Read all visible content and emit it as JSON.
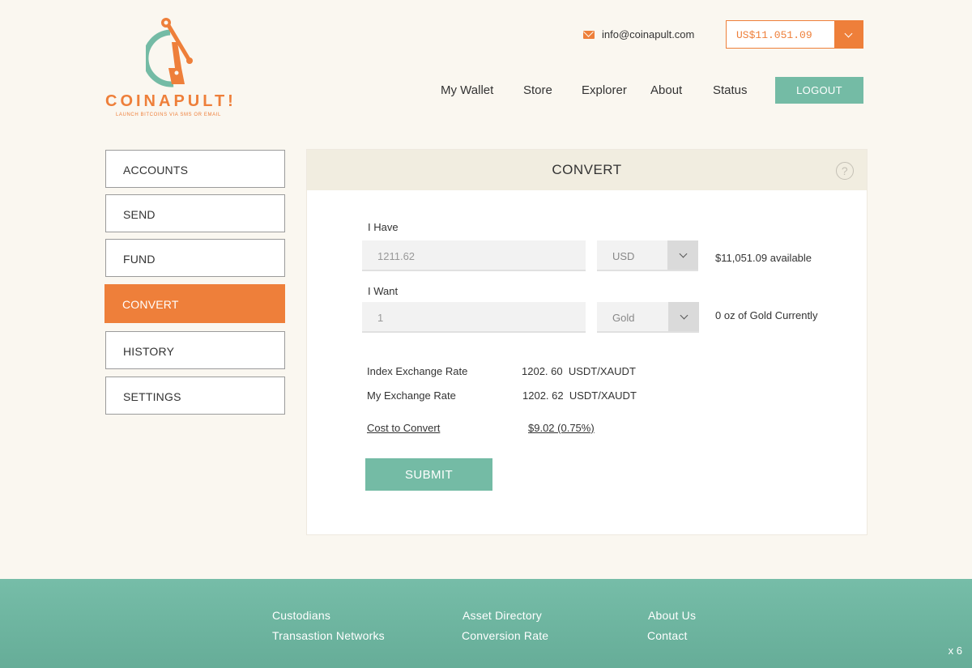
{
  "brand": {
    "name": "COINAPULT!",
    "tagline": "LAUNCH BITCOINS VIA SMS OR EMAIL",
    "accent": "#ee7f3a",
    "teal": "#74bba5"
  },
  "header": {
    "email": "info@coinapult.com",
    "balance": "US$11.051.09",
    "nav": [
      "My Wallet",
      "Store",
      "Explorer",
      "About",
      "Status"
    ],
    "logout": "LOGOUT"
  },
  "sidebar": {
    "items": [
      {
        "label": "ACCOUNTS"
      },
      {
        "label": "SEND"
      },
      {
        "label": "FUND"
      },
      {
        "label": "CONVERT",
        "active": true
      },
      {
        "label": "HISTORY"
      },
      {
        "label": "SETTINGS"
      }
    ]
  },
  "panel": {
    "title": "CONVERT",
    "help_icon": "?",
    "have": {
      "label": "I Have",
      "amount": "1211.62",
      "currency": "USD",
      "note": "$11,051.09 available"
    },
    "want": {
      "label": "I Want",
      "amount": "1",
      "currency": "Gold",
      "note": "0 oz of Gold Currently"
    },
    "rates": {
      "index_label": "Index Exchange Rate",
      "index_value": "1202. 60  USDT/XAUDT",
      "my_label": "My Exchange Rate",
      "my_value": "1202. 62  USDT/XAUDT",
      "cost_label": "Cost to Convert",
      "cost_value": "$9.02 (0.75%)"
    },
    "submit": "SUBMIT"
  },
  "footer": {
    "col1": [
      "Custodians",
      "Transastion Networks"
    ],
    "col2": [
      "Asset Directory",
      "Conversion Rate"
    ],
    "col3": [
      "About Us",
      "Contact"
    ],
    "corner": "x 6"
  }
}
